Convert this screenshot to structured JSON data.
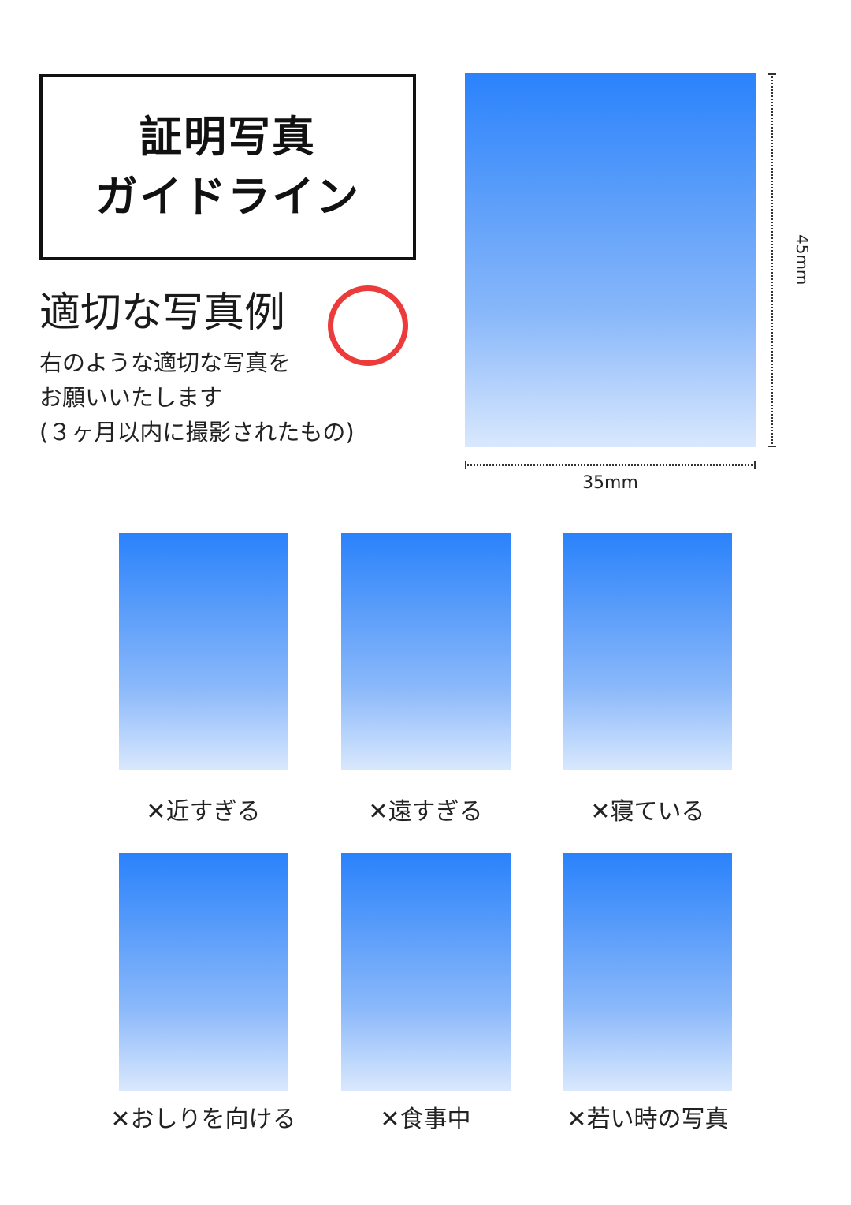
{
  "title": {
    "line1": "証明写真",
    "line2": "ガイドライン"
  },
  "good_example": {
    "heading": "適切な写真例",
    "mark": "circle",
    "description": [
      "右のような適切な写真を",
      "お願いいたします",
      "(３ヶ月以内に撮影されたもの)"
    ]
  },
  "dimensions": {
    "height_label": "45mm",
    "width_label": "35mm"
  },
  "bad_mark": "✕",
  "bad_examples": [
    {
      "label": "近すぎる"
    },
    {
      "label": "遠すぎる"
    },
    {
      "label": "寝ている"
    },
    {
      "label": "おしりを向ける"
    },
    {
      "label": "食事中"
    },
    {
      "label": "若い時の写真"
    }
  ],
  "colors": {
    "photo_top": "#2a82fb",
    "photo_bottom": "#d9e8fd",
    "ok_mark": "#ec3b3b",
    "border": "#111111"
  }
}
